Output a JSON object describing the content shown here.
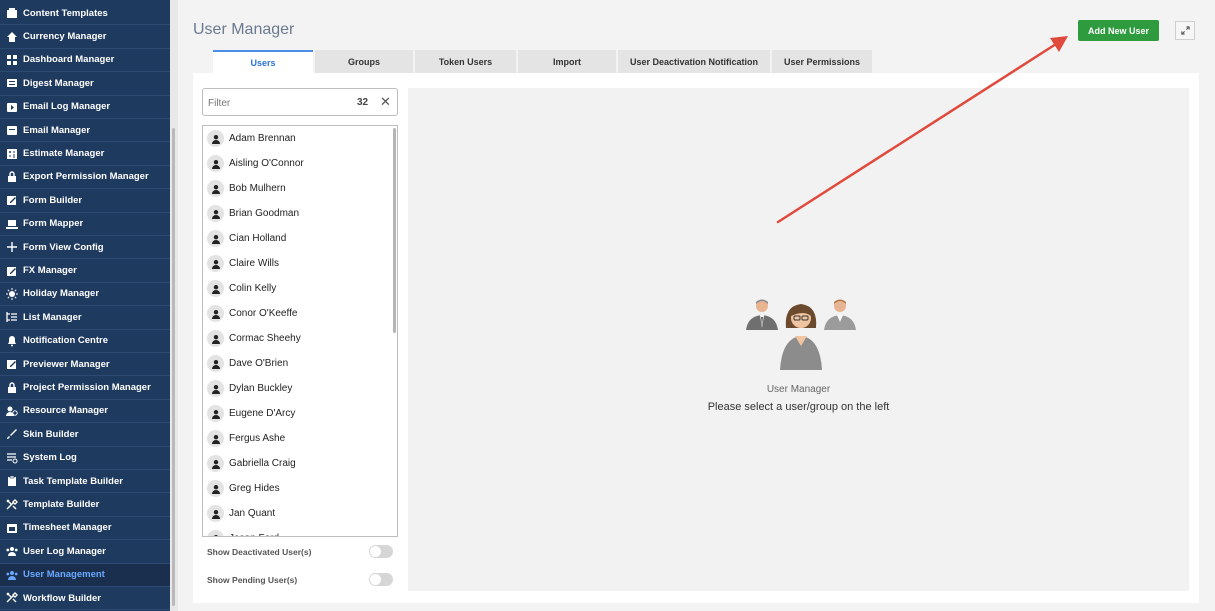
{
  "sidebar": {
    "items": [
      {
        "label": "Content Templates",
        "icon": "template-icon"
      },
      {
        "label": "Currency Manager",
        "icon": "home-icon"
      },
      {
        "label": "Dashboard Manager",
        "icon": "dashboard-icon"
      },
      {
        "label": "Digest Manager",
        "icon": "digest-icon"
      },
      {
        "label": "Email Log Manager",
        "icon": "email-log-icon"
      },
      {
        "label": "Email Manager",
        "icon": "email-icon"
      },
      {
        "label": "Estimate Manager",
        "icon": "calculator-icon"
      },
      {
        "label": "Export Permission Manager",
        "icon": "lock-icon"
      },
      {
        "label": "Form Builder",
        "icon": "edit-icon"
      },
      {
        "label": "Form Mapper",
        "icon": "laptop-icon"
      },
      {
        "label": "Form View Config",
        "icon": "plus-icon"
      },
      {
        "label": "FX Manager",
        "icon": "edit-icon"
      },
      {
        "label": "Holiday Manager",
        "icon": "sun-icon"
      },
      {
        "label": "List Manager",
        "icon": "list-icon"
      },
      {
        "label": "Notification Centre",
        "icon": "bell-icon"
      },
      {
        "label": "Previewer Manager",
        "icon": "edit-icon"
      },
      {
        "label": "Project Permission Manager",
        "icon": "lock-icon"
      },
      {
        "label": "Resource Manager",
        "icon": "resource-icon"
      },
      {
        "label": "Skin Builder",
        "icon": "brush-icon"
      },
      {
        "label": "System Log",
        "icon": "log-icon"
      },
      {
        "label": "Task Template Builder",
        "icon": "clipboard-icon"
      },
      {
        "label": "Template Builder",
        "icon": "tools-icon"
      },
      {
        "label": "Timesheet Manager",
        "icon": "calendar-icon"
      },
      {
        "label": "User Log Manager",
        "icon": "users-icon"
      },
      {
        "label": "User Management",
        "icon": "users-icon",
        "active": true
      },
      {
        "label": "Workflow Builder",
        "icon": "tools-icon"
      }
    ]
  },
  "header": {
    "title": "User Manager",
    "add_button": "Add New User",
    "expand_icon": "expand-icon"
  },
  "tabs": [
    {
      "label": "Users",
      "active": true
    },
    {
      "label": "Groups"
    },
    {
      "label": "Token Users"
    },
    {
      "label": "Import"
    },
    {
      "label": "User Deactivation Notification"
    },
    {
      "label": "User Permissions"
    }
  ],
  "filter": {
    "placeholder": "Filter",
    "count": "32"
  },
  "users": [
    "Adam Brennan",
    "Aisling O'Connor",
    "Bob Mulhern",
    "Brian Goodman",
    "Cian Holland",
    "Claire Wills",
    "Colin Kelly",
    "Conor O'Keeffe",
    "Cormac Sheehy",
    "Dave O'Brien",
    "Dylan Buckley",
    "Eugene D'Arcy",
    "Fergus Ashe",
    "Gabriella Craig",
    "Greg Hides",
    "Jan Quant",
    "Jason Ford"
  ],
  "toggles": {
    "deactivated": "Show Deactivated User(s)",
    "pending": "Show Pending User(s)"
  },
  "empty_state": {
    "title": "User Manager",
    "message": "Please select a user/group on the left"
  },
  "colors": {
    "sidebar_bg": "#1f3a5f",
    "active_link": "#6aa8ff",
    "add_button": "#2e9b3e",
    "annotation_arrow": "#e04a3c",
    "active_tab": "#2a73d8"
  }
}
